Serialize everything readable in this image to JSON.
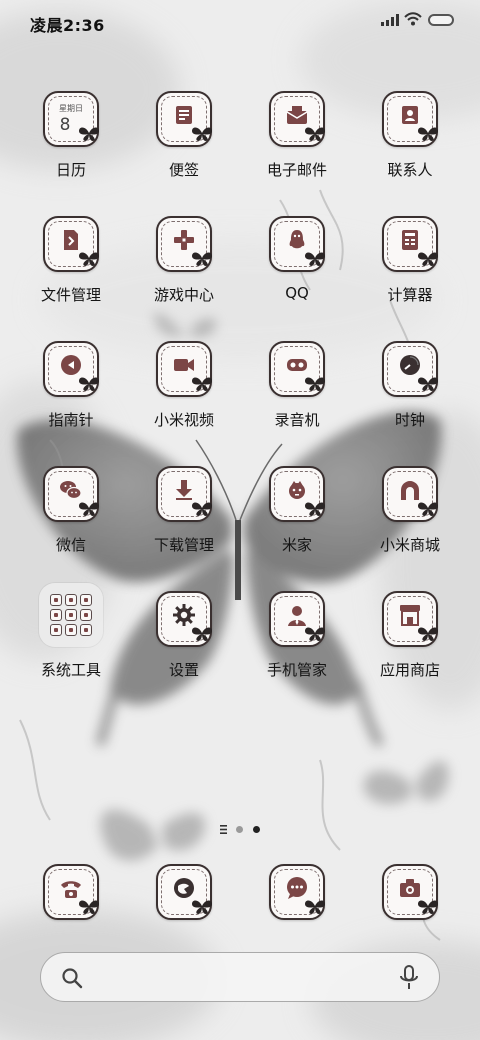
{
  "status_bar": {
    "time": "凌晨2:36"
  },
  "apps": [
    {
      "id": "calendar",
      "label": "日历",
      "icon": "calendar-icon",
      "calendar": {
        "weekday": "星期日",
        "day": "8"
      }
    },
    {
      "id": "notes",
      "label": "便签",
      "icon": "notes-icon"
    },
    {
      "id": "email",
      "label": "电子邮件",
      "icon": "mail-icon"
    },
    {
      "id": "contacts",
      "label": "联系人",
      "icon": "contacts-icon"
    },
    {
      "id": "file-manager",
      "label": "文件管理",
      "icon": "folder-file-icon"
    },
    {
      "id": "game-center",
      "label": "游戏中心",
      "icon": "gamepad-icon"
    },
    {
      "id": "qq",
      "label": "QQ",
      "icon": "qq-penguin-icon"
    },
    {
      "id": "calculator",
      "label": "计算器",
      "icon": "calculator-icon"
    },
    {
      "id": "compass",
      "label": "指南针",
      "icon": "compass-icon"
    },
    {
      "id": "mi-video",
      "label": "小米视频",
      "icon": "video-camera-icon"
    },
    {
      "id": "recorder",
      "label": "录音机",
      "icon": "recorder-icon"
    },
    {
      "id": "clock",
      "label": "时钟",
      "icon": "clock-icon"
    },
    {
      "id": "wechat",
      "label": "微信",
      "icon": "wechat-icon"
    },
    {
      "id": "download-manager",
      "label": "下载管理",
      "icon": "download-icon"
    },
    {
      "id": "mi-home",
      "label": "米家",
      "icon": "mi-home-icon"
    },
    {
      "id": "mi-store",
      "label": "小米商城",
      "icon": "mi-store-icon"
    },
    {
      "id": "system-tools",
      "label": "系统工具",
      "icon": "folder-icon",
      "folder": true
    },
    {
      "id": "settings",
      "label": "设置",
      "icon": "gear-icon"
    },
    {
      "id": "phone-manager",
      "label": "手机管家",
      "icon": "security-agent-icon"
    },
    {
      "id": "app-store",
      "label": "应用商店",
      "icon": "store-icon"
    }
  ],
  "dock": [
    {
      "id": "phone",
      "icon": "phone-icon"
    },
    {
      "id": "browser",
      "icon": "browser-icon"
    },
    {
      "id": "messages",
      "icon": "message-icon"
    },
    {
      "id": "camera",
      "icon": "camera-icon"
    }
  ],
  "page_indicator": {
    "pages": 2,
    "current": 2
  },
  "search": {
    "placeholder": ""
  },
  "colors": {
    "accent": "#7b4646",
    "outline": "#3a3030",
    "tile": "#faf8f7",
    "wallpaper": "#ececec"
  }
}
